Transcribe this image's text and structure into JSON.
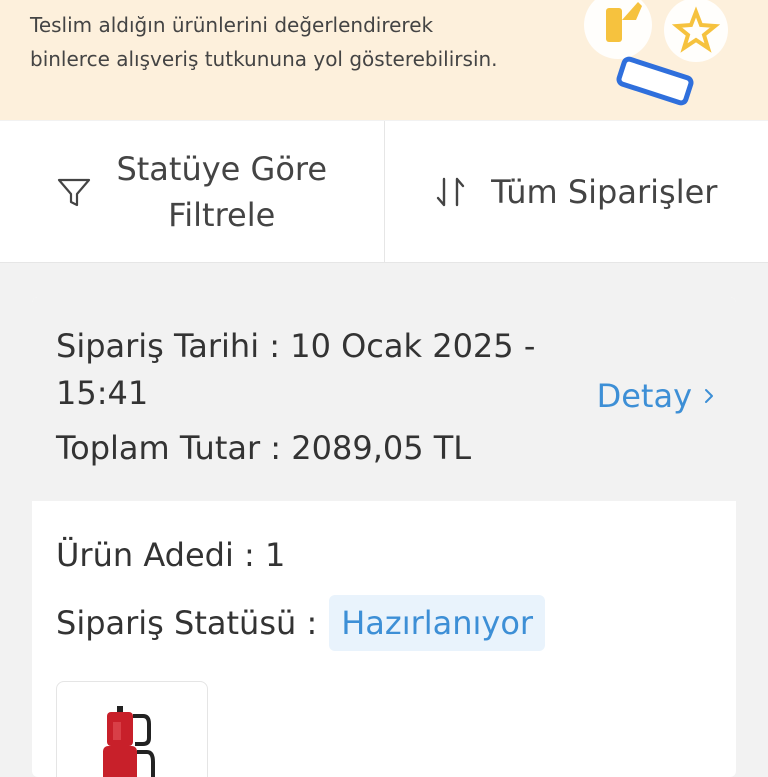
{
  "banner": {
    "line1": "Teslim aldığın ürünlerini değerlendirerek",
    "line2": "binlerce alışveriş tutkununa yol gösterebilirsin."
  },
  "filters": {
    "status_filter_line1": "Statüye Göre",
    "status_filter_line2": "Filtrele",
    "sort_label": "Tüm Siparişler"
  },
  "order": {
    "date_line1": "Sipariş Tarihi : 10 Ocak 2025 -",
    "date_line2": "15:41",
    "total": "Toplam Tutar : 2089,05 TL",
    "detail_label": "Detay",
    "item_count": "Ürün Adedi : 1",
    "status_label": "Sipariş Statüsü :",
    "status_value": "Hazırlanıyor"
  },
  "colors": {
    "banner_bg": "#fdf0dc",
    "link_blue": "#3d8fd6",
    "badge_bg": "#e9f3fc",
    "product_red": "#c8202a"
  },
  "icons": {
    "filter": "funnel-icon",
    "sort": "sort-arrows-icon",
    "detail": "chevron-right-icon"
  }
}
